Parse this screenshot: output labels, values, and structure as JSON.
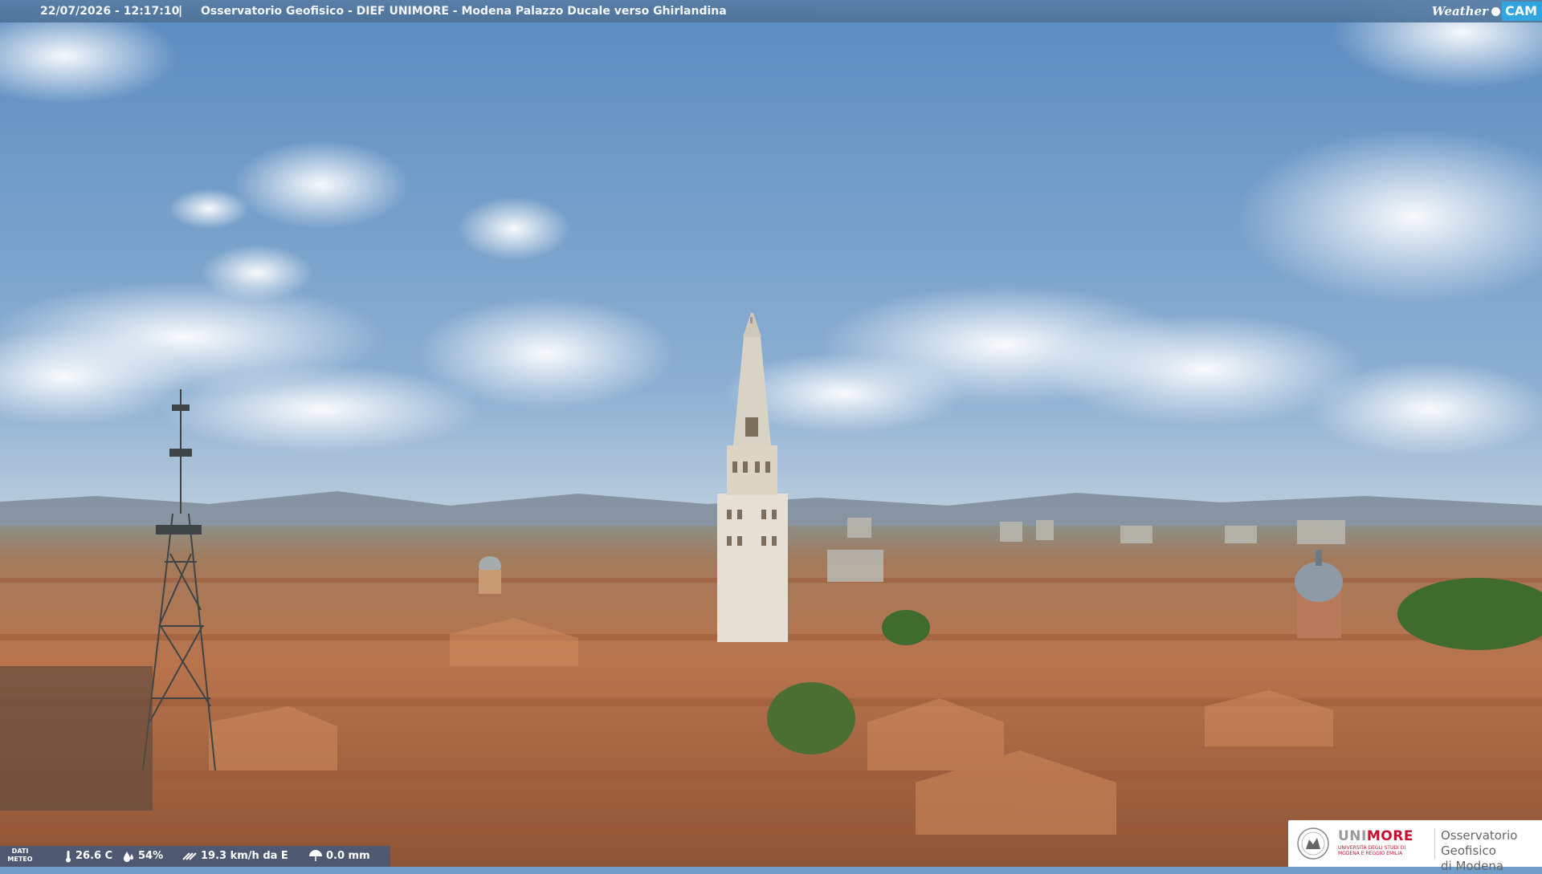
{
  "overlay": {
    "datetime": "22/07/2026 - 12:17:10",
    "separator": "|",
    "title": "Osservatorio Geofisico - DIEF UNIMORE - Modena Palazzo Ducale verso Ghirlandina",
    "logo_weather": "Weather",
    "logo_cam": "CAM"
  },
  "weather": {
    "label_line1": "DATI",
    "label_line2": "METEO",
    "temperature": "26.6 C",
    "humidity": "54%",
    "wind": "19.3 km/h da E",
    "rain": "0.0 mm"
  },
  "logo": {
    "brand_uni": "UNI",
    "brand_more": "MORE",
    "brand_sub": "UNIVERSITÀ DEGLI STUDI DI MODENA E REGGIO EMILIA",
    "observatory_line1": "Osservatorio Geofisico",
    "observatory_line2": "di Modena"
  },
  "colors": {
    "sky_top": "#5f8fc2",
    "sky_bottom": "#c9d6e2",
    "roof": "#b8704a",
    "accent_red": "#c8102e",
    "cam_blue": "#2aa4e0"
  }
}
